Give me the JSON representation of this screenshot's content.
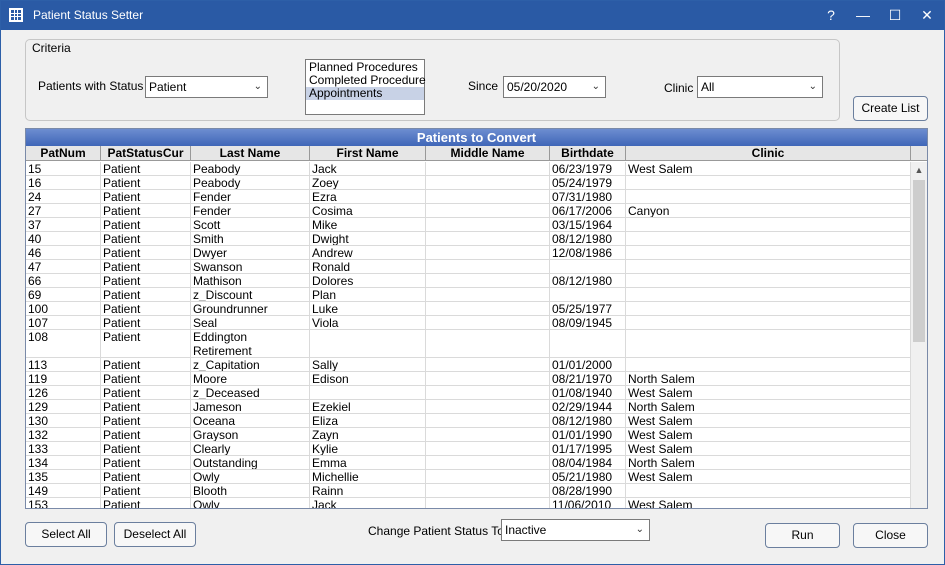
{
  "window": {
    "title": "Patient Status Setter",
    "help": "?",
    "minimize": "—",
    "maximize": "☐",
    "close": "✕"
  },
  "criteria": {
    "legend": "Criteria",
    "patients_with_status_label": "Patients with Status",
    "patients_with_status_value": "Patient",
    "procedures": [
      "Planned Procedures",
      "Completed Procedure",
      "Appointments"
    ],
    "procedures_selected": "Appointments",
    "since_label": "Since",
    "since_value": "05/20/2020",
    "clinic_label": "Clinic",
    "clinic_value": "All"
  },
  "create_list_label": "Create List",
  "grid": {
    "title": "Patients to Convert",
    "columns": [
      "PatNum",
      "PatStatusCur",
      "Last Name",
      "First Name",
      "Middle Name",
      "Birthdate",
      "Clinic"
    ],
    "rows": [
      [
        "15",
        "Patient",
        "Peabody",
        "Jack",
        "",
        "06/23/1979",
        "West Salem"
      ],
      [
        "16",
        "Patient",
        "Peabody",
        "Zoey",
        "",
        "05/24/1979",
        ""
      ],
      [
        "24",
        "Patient",
        "Fender",
        "Ezra",
        "",
        "07/31/1980",
        ""
      ],
      [
        "27",
        "Patient",
        "Fender",
        "Cosima",
        "",
        "06/17/2006",
        "Canyon"
      ],
      [
        "37",
        "Patient",
        "Scott",
        "Mike",
        "",
        "03/15/1964",
        ""
      ],
      [
        "40",
        "Patient",
        "Smith",
        "Dwight",
        "",
        "08/12/1980",
        ""
      ],
      [
        "46",
        "Patient",
        "Dwyer",
        "Andrew",
        "",
        "12/08/1986",
        ""
      ],
      [
        "47",
        "Patient",
        "Swanson",
        "Ronald",
        "",
        "",
        ""
      ],
      [
        "66",
        "Patient",
        "Mathison",
        "Dolores",
        "",
        "08/12/1980",
        ""
      ],
      [
        "69",
        "Patient",
        "z_Discount",
        "Plan",
        "",
        "",
        ""
      ],
      [
        "100",
        "Patient",
        "Groundrunner",
        "Luke",
        "",
        "05/25/1977",
        ""
      ],
      [
        "107",
        "Patient",
        "Seal",
        "Viola",
        "",
        "08/09/1945",
        ""
      ],
      [
        "108",
        "Patient",
        "Eddington Retirement Community Home",
        "",
        "",
        "",
        ""
      ],
      [
        "113",
        "Patient",
        "z_Capitation",
        "Sally",
        "",
        "01/01/2000",
        ""
      ],
      [
        "119",
        "Patient",
        "Moore",
        "Edison",
        "",
        "08/21/1970",
        "North Salem"
      ],
      [
        "126",
        "Patient",
        "z_Deceased",
        "",
        "",
        "01/08/1940",
        "West Salem"
      ],
      [
        "129",
        "Patient",
        "Jameson",
        "Ezekiel",
        "",
        "02/29/1944",
        "North Salem"
      ],
      [
        "130",
        "Patient",
        "Oceana",
        "Eliza",
        "",
        "08/12/1980",
        "West Salem"
      ],
      [
        "132",
        "Patient",
        "Grayson",
        "Zayn",
        "",
        "01/01/1990",
        "West Salem"
      ],
      [
        "133",
        "Patient",
        "Clearly",
        "Kylie",
        "",
        "01/17/1995",
        "West Salem"
      ],
      [
        "134",
        "Patient",
        "Outstanding",
        "Emma",
        "",
        "08/04/1984",
        "North Salem"
      ],
      [
        "135",
        "Patient",
        "Owly",
        "Michellie",
        "",
        "05/21/1980",
        "West Salem"
      ],
      [
        "149",
        "Patient",
        "Blooth",
        "Rainn",
        "",
        "08/28/1990",
        ""
      ],
      [
        "153",
        "Patient",
        "Owly",
        "Jack",
        "",
        "11/06/2010",
        "West Salem"
      ]
    ]
  },
  "footer": {
    "select_all": "Select All",
    "deselect_all": "Deselect All",
    "change_status_label": "Change Patient Status To",
    "change_status_value": "Inactive",
    "run": "Run",
    "close": "Close"
  },
  "icons": {
    "dropdown": "chevron-down-icon",
    "app": "grid-app-icon"
  }
}
